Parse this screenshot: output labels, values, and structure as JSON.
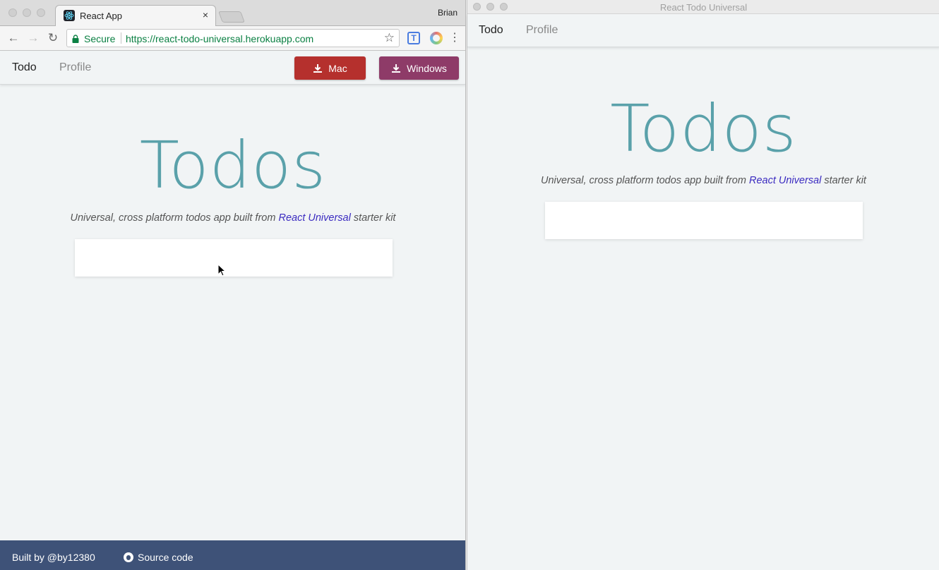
{
  "browser": {
    "tab_title": "React App",
    "tab_close": "×",
    "profile_name": "Brian",
    "secure_label": "Secure",
    "url": "https://react-todo-universal.herokuapp.com",
    "back_icon": "←",
    "forward_icon": "→",
    "reload_icon": "↻",
    "star_icon": "☆",
    "menu_icon": "⋮",
    "ext_icon_text": "T"
  },
  "web": {
    "nav": {
      "todo": "Todo",
      "profile": "Profile"
    },
    "download_mac": "Mac",
    "download_windows": "Windows",
    "title": "Todos",
    "subtitle_before": "Universal, cross platform todos app built from ",
    "subtitle_link": "React Universal",
    "subtitle_after": " starter kit",
    "input_value": "",
    "footer_built_by": "Built by @by12380",
    "footer_source": "Source code"
  },
  "electron": {
    "window_title": "React Todo Universal",
    "nav": {
      "todo": "Todo",
      "profile": "Profile"
    },
    "title": "Todos",
    "subtitle_before": "Universal, cross platform todos app built from ",
    "subtitle_link": "React Universal",
    "subtitle_after": " starter kit",
    "input_value": ""
  },
  "colors": {
    "title": "#5aa1aa",
    "mac_button": "#b5302d",
    "windows_button": "#8e3b68",
    "footer": "#3e5278",
    "link": "#3a2ac0",
    "secure_green": "#0b8043"
  }
}
